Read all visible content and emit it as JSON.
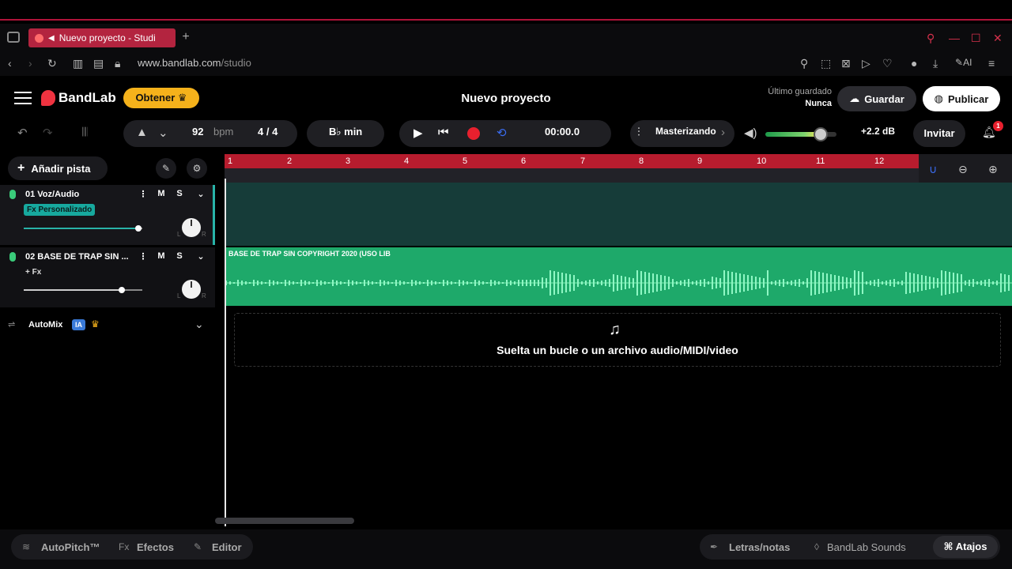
{
  "browser": {
    "tab_title": "Nuevo proyecto - Studi",
    "url_host": "www.bandlab.com",
    "url_path": "/studio",
    "ai_label": "AI"
  },
  "header": {
    "brand": "BandLab",
    "obtener_label": "Obtener",
    "project_title": "Nuevo proyecto",
    "last_saved_label": "Último guardado",
    "last_saved_value": "Nunca",
    "guardar_label": "Guardar",
    "publicar_label": "Publicar"
  },
  "toolbar": {
    "tempo": "92",
    "tempo_unit": "bpm",
    "time_signature": "4 / 4",
    "key": "B♭ min",
    "timecode": "00:00.0",
    "mastering_label": "Masterizando",
    "volume_db": "+2.2 dB",
    "invitar_label": "Invitar",
    "notification_count": "1"
  },
  "left_panel": {
    "add_track_label": "Añadir pista",
    "tracks": [
      {
        "name": "01  Voz/Audio",
        "fx": "Fx Personalizado",
        "mute": "M",
        "solo": "S",
        "volume": 0.98
      },
      {
        "name": "02  BASE DE TRAP SIN ...",
        "fx": "+ Fx",
        "mute": "M",
        "solo": "S",
        "volume": 0.71
      }
    ],
    "pan_left": "L",
    "pan_right": "R",
    "automix_label": "AutoMix",
    "ia_badge": "IA"
  },
  "timeline": {
    "bars": [
      "1",
      "2",
      "3",
      "4",
      "5",
      "6",
      "7",
      "8",
      "9",
      "10",
      "11",
      "12"
    ],
    "clip_title": "BASE DE TRAP SIN COPYRIGHT 2020 (USO LIB",
    "drop_text": "Suelta un bucle o un archivo audio/MIDI/video"
  },
  "bottom": {
    "autopitch": "AutoPitch™",
    "effects_prefix": "Fx",
    "effects": "Efectos",
    "editor": "Editor",
    "lyrics": "Letras/notas",
    "sounds": "BandLab Sounds",
    "shortcuts": "Atajos"
  },
  "colors": {
    "accent_red": "#e8202e",
    "ruler_red": "#b71c2e",
    "track_teal": "#28b3a8",
    "clip_green": "#1ea96a",
    "obtener_yellow": "#f5b21b"
  }
}
